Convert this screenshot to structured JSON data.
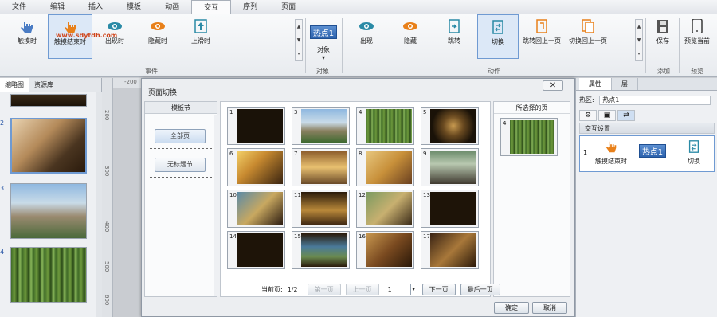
{
  "menu": {
    "tabs": [
      "文件",
      "编辑",
      "插入",
      "模板",
      "动画",
      "交互",
      "序列",
      "页面"
    ],
    "active_index": 5
  },
  "ribbon": {
    "event_buttons": [
      {
        "label": "触摸时",
        "icon": "hand-pointer-icon"
      },
      {
        "label": "触摸结束时",
        "icon": "hand-tap-icon"
      },
      {
        "label": "出现时",
        "icon": "eye-icon"
      },
      {
        "label": "隐藏时",
        "icon": "eye-hidden-icon"
      },
      {
        "label": "上滑时",
        "icon": "swipe-up-icon"
      }
    ],
    "event_group_label": "事件",
    "object_badge": "热点1",
    "object_label": "对象",
    "object_group_label": "对象",
    "action_buttons": [
      {
        "label": "出现",
        "icon": "eye-icon"
      },
      {
        "label": "隐藏",
        "icon": "eye-hidden-icon"
      },
      {
        "label": "跳转",
        "icon": "jump-icon"
      },
      {
        "label": "切换",
        "icon": "switch-icon"
      },
      {
        "label": "跳转回上一页",
        "icon": "jump-back-icon"
      },
      {
        "label": "切换回上一页",
        "icon": "switch-back-icon"
      }
    ],
    "action_group_label": "动作",
    "add_buttons": [
      {
        "label": "保存",
        "icon": "save-icon"
      }
    ],
    "add_group_label": "添加",
    "preview_buttons": [
      {
        "label": "预览当前",
        "icon": "tablet-icon"
      }
    ],
    "preview_group_label": "预览",
    "watermark": "www.sdytdh.com"
  },
  "left_panel": {
    "tabs": [
      "缩略图",
      "资源库"
    ],
    "thumbnails": [
      {
        "num": "2",
        "selected": true
      },
      {
        "num": "3",
        "selected": false
      },
      {
        "num": "4",
        "selected": false
      }
    ],
    "ruler_labels": [
      "200",
      "300",
      "400",
      "500",
      "600"
    ],
    "ruler_top_label": "-200"
  },
  "dialog": {
    "title": "页面切换",
    "close_label": "✕",
    "sections_header": "模板节",
    "section_buttons": [
      "全部页",
      "无标题节"
    ],
    "pages": [
      "1",
      "3",
      "4",
      "5",
      "6",
      "7",
      "8",
      "9",
      "10",
      "11",
      "12",
      "13",
      "14",
      "15",
      "16",
      "17"
    ],
    "selected_header": "所选择的页",
    "selected_page": "4",
    "pager": {
      "current_label": "当前页:",
      "current_value": "1/2",
      "first_label": "第一页",
      "prev_label": "上一页",
      "select_value": "1",
      "next_label": "下一页",
      "last_label": "最后一页"
    },
    "ok_label": "确定",
    "cancel_label": "取消"
  },
  "right_panel": {
    "tabs": [
      "属性",
      "层"
    ],
    "hotzone_label": "热区:",
    "hotzone_value": "热点1",
    "interaction_header": "交互设置",
    "row_num": "1",
    "row_trigger": "触摸结束时",
    "row_object": "热点1",
    "row_action": "切换"
  },
  "colors": {
    "accent_blue": "#6f9ad2",
    "orange_icon": "#e8801a",
    "teal_icon": "#2a8aa6"
  }
}
